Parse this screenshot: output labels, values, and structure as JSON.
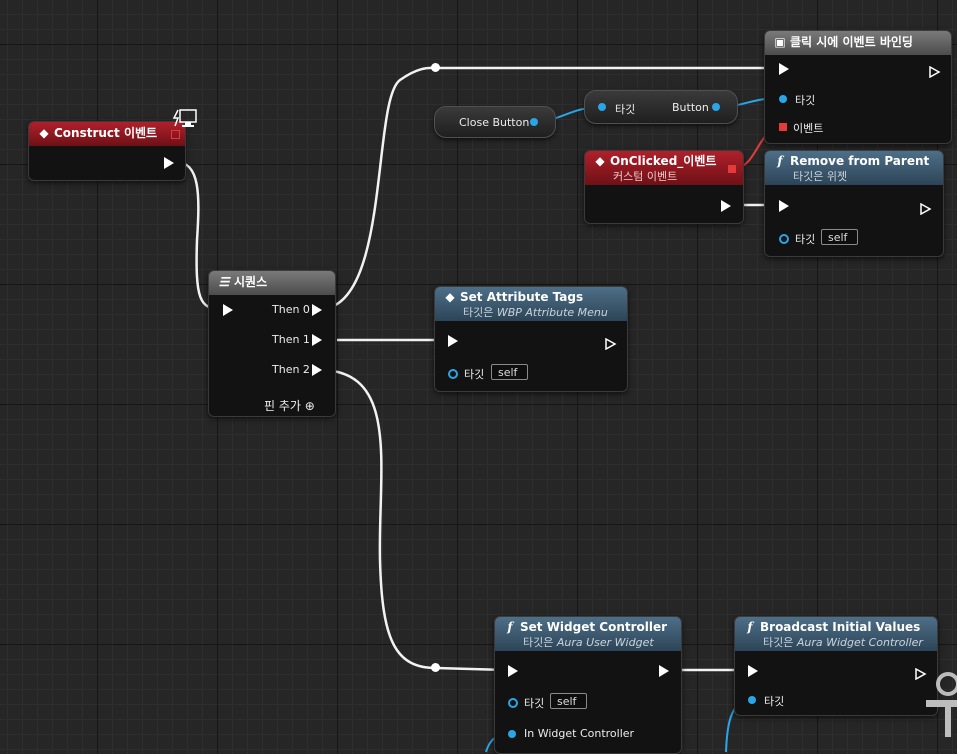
{
  "nodes": {
    "construct": {
      "title": "Construct 이벤트"
    },
    "sequence": {
      "title": "시퀀스",
      "then0": "Then 0",
      "then1": "Then 1",
      "then2": "Then 2",
      "add_pin": "핀 추가"
    },
    "bind_click": {
      "title": "클릭 시에 이벤트 바인딩",
      "target": "타깃",
      "event": "이벤트"
    },
    "close_button": {
      "label": "Close Button"
    },
    "cast_button": {
      "left": "타깃",
      "right": "Button"
    },
    "onclicked": {
      "title": "OnClicked_이벤트",
      "subtitle": "커스텀 이벤트"
    },
    "remove_parent": {
      "title": "Remove from Parent",
      "subtitle": "타깃은 위젯",
      "target": "타깃",
      "self": "self"
    },
    "set_attr_tags": {
      "title": "Set Attribute Tags",
      "subtitle_prefix": "타깃은 ",
      "subtitle_class": "WBP Attribute Menu",
      "target": "타깃",
      "self": "self"
    },
    "set_widget_controller": {
      "title": "Set Widget Controller",
      "subtitle_prefix": "타깃은 ",
      "subtitle_class": "Aura User Widget",
      "target": "타깃",
      "self": "self",
      "in_widget": "In Widget Controller"
    },
    "broadcast": {
      "title": "Broadcast Initial Values",
      "subtitle_prefix": "타깃은 ",
      "subtitle_class": "Aura Widget Controller",
      "target": "타깃"
    }
  },
  "colors": {
    "exec_wire": "#ffffff",
    "object_pin": "#29a6e8",
    "event_pin": "#e43a3a"
  }
}
